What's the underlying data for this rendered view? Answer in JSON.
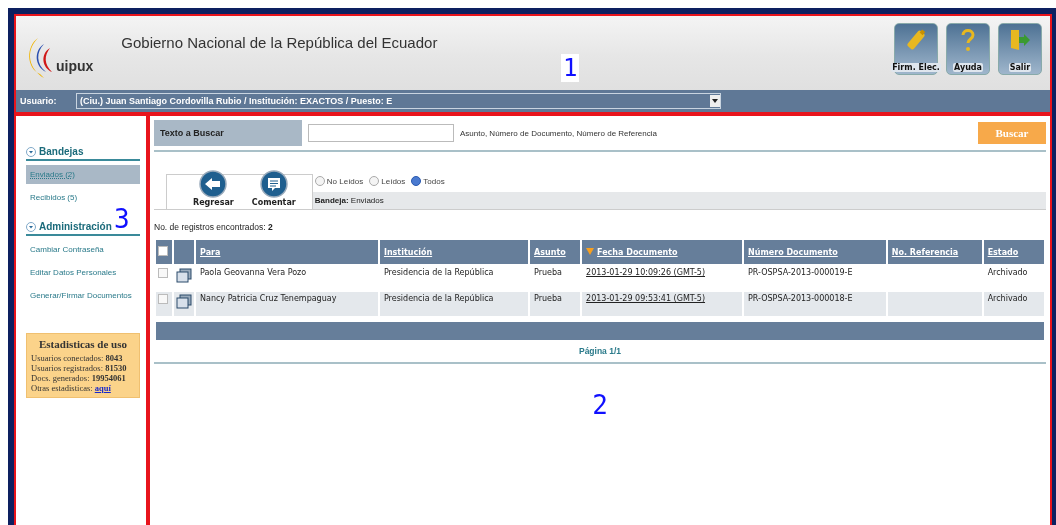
{
  "header": {
    "logo_text": "uipux",
    "title": "Gobierno Nacional de la República del Ecuador",
    "annotation": "1",
    "buttons": [
      {
        "kind": "usb",
        "label": "Firm. Elec."
      },
      {
        "kind": "help",
        "label": "Ayuda"
      },
      {
        "kind": "exit",
        "label": "Salir"
      }
    ]
  },
  "user_bar": {
    "label": "Usuario:",
    "value": "(Ciu.) Juan Santiago Cordovilla Rubio / Institución: EXACTOS / Puesto: E"
  },
  "sidebar": {
    "annotation": "3",
    "sections": [
      {
        "title": "Bandejas",
        "items": [
          {
            "label": "Enviados (2)",
            "selected": true
          },
          {
            "label": "Recibidos (5)",
            "selected": false
          }
        ]
      },
      {
        "title": "Administración",
        "items": [
          {
            "label": "Cambiar Contraseña",
            "selected": false
          },
          {
            "label": "Editar Datos Personales",
            "selected": false
          },
          {
            "label": "Generar/Firmar Documentos",
            "selected": false
          }
        ]
      }
    ],
    "stats": {
      "title": "Estadisticas de uso",
      "lines": [
        {
          "label": "Usuarios conectados:",
          "value": "8043"
        },
        {
          "label": "Usuarios registrados:",
          "value": "81530"
        },
        {
          "label": "Docs. generados:",
          "value": "19954061"
        }
      ],
      "link_label": "Otras estadisticas:",
      "link": "aquí"
    }
  },
  "search": {
    "label": "Texto a Buscar",
    "hint": "Asunto, Número de Documento, Número de Referencia",
    "button": "Buscar"
  },
  "actions": [
    {
      "kind": "back",
      "label": "Regresar"
    },
    {
      "kind": "comment",
      "label": "Comentar"
    }
  ],
  "filters": [
    {
      "label": "No Leídos",
      "selected": false
    },
    {
      "label": "Leídos",
      "selected": false
    },
    {
      "label": "Todos",
      "selected": true
    }
  ],
  "tray": {
    "label": "Bandeja:",
    "value": "Enviados"
  },
  "records": {
    "label": "No. de registros encontrados:",
    "value": "2"
  },
  "table": {
    "select_all_checked": false,
    "columns": [
      {
        "label": "Para",
        "sorted": false
      },
      {
        "label": "Institución",
        "sorted": false
      },
      {
        "label": "Asunto",
        "sorted": false
      },
      {
        "label": "Fecha Documento",
        "sorted": true
      },
      {
        "label": "Número Documento",
        "sorted": false
      },
      {
        "label": "No. Referencia",
        "sorted": false
      },
      {
        "label": "Estado",
        "sorted": false
      }
    ],
    "rows": [
      {
        "checked": false,
        "para": "Paola Geovanna Vera Pozo",
        "institucion": "Presidencia de la República",
        "asunto": "Prueba",
        "fecha": "2013-01-29 10:09:26 (GMT-5)",
        "numero": "PR-OSPSA-2013-000019-E",
        "estado": "Archivado"
      },
      {
        "checked": false,
        "para": "Nancy Patricia Cruz Tenempaguay",
        "institucion": "Presidencia de la República",
        "asunto": "Prueba",
        "fecha": "2013-01-29 09:53:41 (GMT-5)",
        "numero": "PR-OSPSA-2013-000018-E",
        "estado": "Archivado"
      }
    ]
  },
  "pagination": "Página 1/1",
  "content_annotation": "2"
}
